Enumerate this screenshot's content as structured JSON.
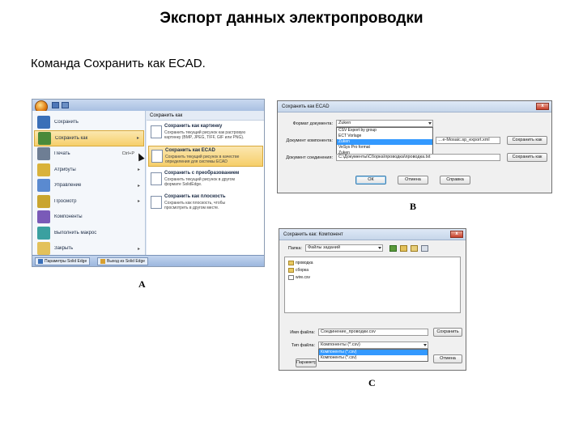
{
  "slide": {
    "title": "Экспорт данных электропроводки",
    "subtitle": "Команда Сохранить как ECAD.",
    "labels": {
      "a": "A",
      "b": "B",
      "c": "C"
    }
  },
  "shot_a": {
    "menu": [
      {
        "label": "Сохранить",
        "icon": "save-icon",
        "has_arrow": false,
        "shortcut": ""
      },
      {
        "label": "Сохранить как",
        "icon": "save-as-icon",
        "has_arrow": true,
        "shortcut": "",
        "selected": true
      },
      {
        "label": "Печать",
        "icon": "print-icon",
        "has_arrow": false,
        "shortcut": "Ctrl+P"
      },
      {
        "label": "Атрибуты",
        "icon": "attributes-icon",
        "has_arrow": true,
        "shortcut": ""
      },
      {
        "label": "Управление",
        "icon": "manage-icon",
        "has_arrow": true,
        "shortcut": ""
      },
      {
        "label": "Просмотр",
        "icon": "view-icon",
        "has_arrow": true,
        "shortcut": ""
      },
      {
        "label": "Компоненты",
        "icon": "components-icon",
        "has_arrow": false,
        "shortcut": ""
      },
      {
        "label": "Выполнить макрос",
        "icon": "macro-icon",
        "has_arrow": false,
        "shortcut": ""
      },
      {
        "label": "Закрыть",
        "icon": "close-doc-icon",
        "has_arrow": true,
        "shortcut": ""
      }
    ],
    "submenu_header": "Сохранить как",
    "submenu": [
      {
        "title": "Сохранить как картинку",
        "line1": "Сохранить текущий рисунок как растровую",
        "line2": "картинку (BMP, JPEG, TIFF, GIF или PNG)."
      },
      {
        "title": "Сохранить как ECAD",
        "line1": "Сохранить текущий рисунок в качестве",
        "line2": "определения для системы ECAD",
        "selected": true
      },
      {
        "title": "Сохранить с преобразованием",
        "line1": "Сохранить текущий рисунок в другом",
        "line2": "формате SolidEdge."
      },
      {
        "title": "Сохранить как плоскость",
        "line1": "Сохранить как плоскость, чтобы",
        "line2": "просмотреть в другом месте."
      }
    ],
    "taskbar": [
      "Параметры Solid Edge",
      "Выход из Solid Edge"
    ]
  },
  "shot_b": {
    "title": "Сохранить как ECAD",
    "format_label": "Формат документа:",
    "format_value": "Zuken",
    "format_options": [
      "CSV Export by group",
      "ECT Vorlage",
      "Zuken",
      "VeSys Pro format",
      "Zuken"
    ],
    "format_selected_index": 2,
    "component_label": "Документ компонента:",
    "component_value": "…e-Mosaic.sp_export.xml",
    "wiring_label": "Документ соединения:",
    "wiring_value": "C:\\Документы\\Сборка\\проводка\\проводка.txt",
    "browse1": "Сохранить как",
    "browse2": "Сохранить как",
    "ok": "ОК",
    "cancel": "Отмена",
    "help": "Справка",
    "close_glyph": "x"
  },
  "shot_c": {
    "title": "Сохранить как: Компонент",
    "folder_label": "Папка:",
    "folder_value": "Файлы заданий",
    "files": [
      {
        "name": "проводка",
        "type": "folder"
      },
      {
        "name": "сборка",
        "type": "folder"
      },
      {
        "name": "wire.csv",
        "type": "file"
      }
    ],
    "filename_label": "Имя файла:",
    "filename_value": "Соединение_проводки.csv",
    "filetype_label": "Тип файла:",
    "filetype_value": "Компоненты (*.csv)",
    "filetype_options": [
      "Компоненты (*.csv)",
      "Компоненты (*.csv)"
    ],
    "filetype_selected_index": 0,
    "save": "Сохранить",
    "cancel": "Отмена",
    "options": "Параметры",
    "close_glyph": "x"
  }
}
